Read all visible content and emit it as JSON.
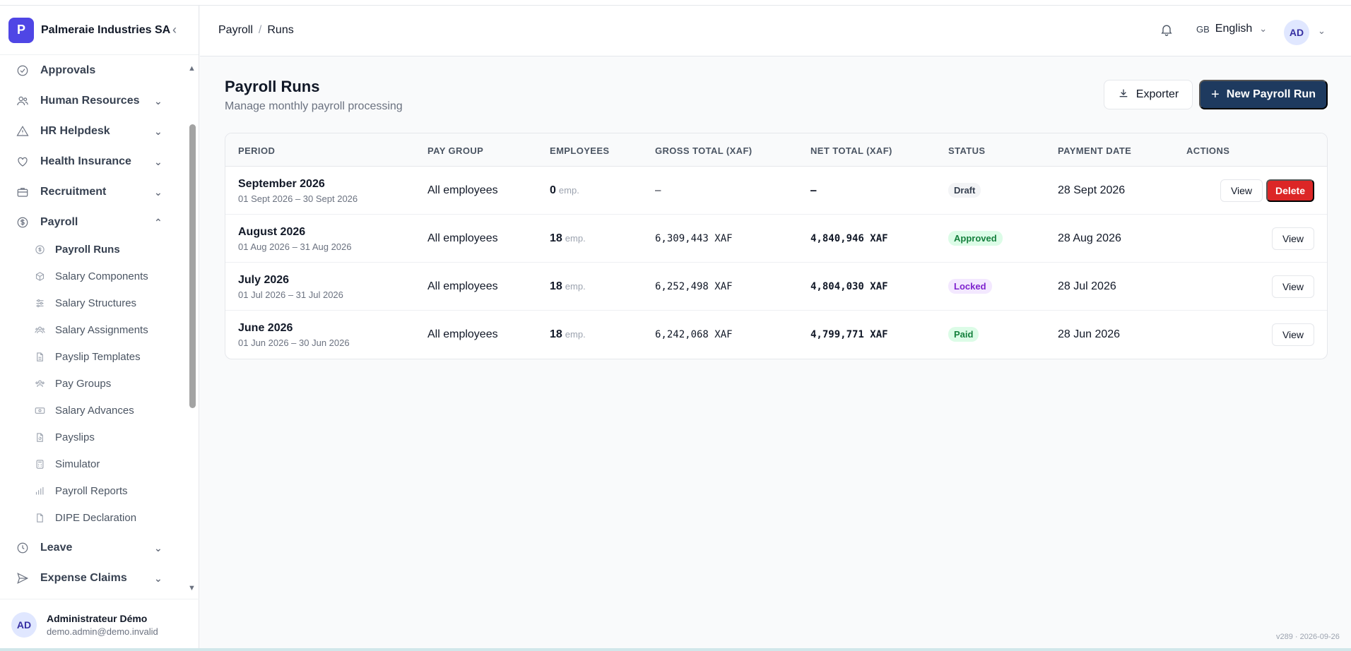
{
  "org": {
    "logo_letter": "P",
    "name": "Palmeraie Industries SA",
    "collapse_glyph": "‹"
  },
  "sidebar": {
    "items": [
      {
        "label": "Approvals",
        "icon": "check-circle-icon",
        "chevron": ""
      },
      {
        "label": "Human Resources",
        "icon": "users-icon",
        "chevron": "⌄"
      },
      {
        "label": "HR Helpdesk",
        "icon": "alert-triangle-icon",
        "chevron": "⌄"
      },
      {
        "label": "Health Insurance",
        "icon": "heart-icon",
        "chevron": "⌄"
      },
      {
        "label": "Recruitment",
        "icon": "briefcase-icon",
        "chevron": "⌄"
      },
      {
        "label": "Payroll",
        "icon": "dollar-circle-icon",
        "chevron": "⌃"
      },
      {
        "label": "Leave",
        "icon": "clock-icon",
        "chevron": "⌄"
      },
      {
        "label": "Expense Claims",
        "icon": "send-icon",
        "chevron": "⌄"
      }
    ],
    "payroll_sub": [
      {
        "label": "Payroll Runs",
        "icon": "dollar-icon"
      },
      {
        "label": "Salary Components",
        "icon": "box-icon"
      },
      {
        "label": "Salary Structures",
        "icon": "sliders-icon"
      },
      {
        "label": "Salary Assignments",
        "icon": "user-group-icon"
      },
      {
        "label": "Payslip Templates",
        "icon": "file-icon"
      },
      {
        "label": "Pay Groups",
        "icon": "group-icon"
      },
      {
        "label": "Salary Advances",
        "icon": "banknote-icon"
      },
      {
        "label": "Payslips",
        "icon": "file-refresh-icon"
      },
      {
        "label": "Simulator",
        "icon": "calculator-icon"
      },
      {
        "label": "Payroll Reports",
        "icon": "bar-chart-icon"
      },
      {
        "label": "DIPE Declaration",
        "icon": "file-text-icon"
      }
    ]
  },
  "user": {
    "initials": "AD",
    "name": "Administrateur Démo",
    "email": "demo.admin@demo.invalid"
  },
  "header": {
    "breadcrumb": [
      "Payroll",
      "Runs"
    ],
    "breadcrumb_sep": "/",
    "lang_flag": "GB",
    "lang_label": "English",
    "avatar_initials": "AD",
    "chevron": "⌄"
  },
  "page": {
    "title": "Payroll Runs",
    "subtitle": "Manage monthly payroll processing",
    "export_label": "Exporter",
    "new_label": "New Payroll Run",
    "new_glyph": "+"
  },
  "table": {
    "columns": [
      "PERIOD",
      "PAY GROUP",
      "EMPLOYEES",
      "GROSS TOTAL (XAF)",
      "NET TOTAL (XAF)",
      "STATUS",
      "PAYMENT DATE",
      "ACTIONS"
    ],
    "rows": [
      {
        "period": "September 2026",
        "range": "01 Sept 2026 – 30 Sept 2026",
        "group": "All employees",
        "emp": "0",
        "emp_unit": "emp.",
        "gross": "–",
        "net": "–",
        "status": "Draft",
        "status_key": "draft",
        "pay_date": "28 Sept 2026",
        "view": "View",
        "delete": "Delete"
      },
      {
        "period": "August 2026",
        "range": "01 Aug 2026 – 31 Aug 2026",
        "group": "All employees",
        "emp": "18",
        "emp_unit": "emp.",
        "gross": "6,309,443 XAF",
        "net": "4,840,946 XAF",
        "status": "Approved",
        "status_key": "approved",
        "pay_date": "28 Aug 2026",
        "view": "View"
      },
      {
        "period": "July 2026",
        "range": "01 Jul 2026 – 31 Jul 2026",
        "group": "All employees",
        "emp": "18",
        "emp_unit": "emp.",
        "gross": "6,252,498 XAF",
        "net": "4,804,030 XAF",
        "status": "Locked",
        "status_key": "locked",
        "pay_date": "28 Jul 2026",
        "view": "View"
      },
      {
        "period": "June 2026",
        "range": "01 Jun 2026 – 30 Jun 2026",
        "group": "All employees",
        "emp": "18",
        "emp_unit": "emp.",
        "gross": "6,242,068 XAF",
        "net": "4,799,771 XAF",
        "status": "Paid",
        "status_key": "paid",
        "pay_date": "28 Jun 2026",
        "view": "View"
      }
    ]
  },
  "version": "v289 · 2026-09-26",
  "colors": {
    "brand": "#4f46e5",
    "primary_button": "#1e3a5f",
    "delete": "#dc2626"
  }
}
